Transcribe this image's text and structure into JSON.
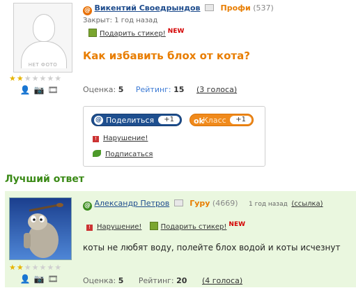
{
  "question": {
    "avatar_caption": "НЕТ ФОТО",
    "stars": {
      "filled": 2,
      "total": 7
    },
    "author": "Викентий Своедрындов",
    "rank": "Профи",
    "rank_points": "(537)",
    "closed": "Закрыт: 1 год назад",
    "gift_link": "Подарить стикер!",
    "new_badge": "NEW",
    "title": "Как избавить блох от кота?",
    "score_label": "Оценка:",
    "score_value": "5",
    "rating_label": "Рейтинг:",
    "rating_value": "15",
    "votes": "(3 голоса)"
  },
  "share": {
    "share_label": "Поделиться",
    "share_count": "+1",
    "class_label": "Класс",
    "class_count": "+1",
    "violation": "Нарушение!",
    "subscribe": "Подписаться"
  },
  "best_answer": {
    "heading": "Лучший ответ",
    "author": "Александр Петров",
    "rank": "Гуру",
    "rank_points": "(4669)",
    "time": "1 год назад",
    "link": "(ссылка)",
    "violation": "Нарушение!",
    "gift_link": "Подарить стикер!",
    "new_badge": "NEW",
    "text": "коты не любят воду, полейте блох водой и коты исчезнут",
    "stars": {
      "filled": 2,
      "total": 7
    },
    "score_label": "Оценка:",
    "score_value": "5",
    "rating_label": "Рейтинг:",
    "rating_value": "20",
    "votes": "(4 голоса)"
  },
  "icons": [
    "person-icon",
    "camera-icon",
    "film-icon"
  ],
  "colors": {
    "accent_orange": "#e87d00",
    "best_green": "#3b8a17",
    "answer_bg": "#eaf7df",
    "link_blue": "#1d4b8c"
  }
}
